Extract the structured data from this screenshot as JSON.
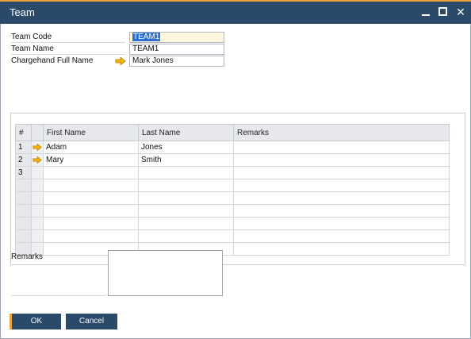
{
  "window": {
    "title": "Team"
  },
  "header": {
    "team_code": {
      "label": "Team Code",
      "value": "TEAM1"
    },
    "team_name": {
      "label": "Team Name",
      "value": "TEAM1"
    },
    "chargehand": {
      "label": "Chargehand Full Name",
      "value": "Mark Jones"
    }
  },
  "grid": {
    "columns": [
      "#",
      "",
      "First Name",
      "Last Name",
      "Remarks"
    ],
    "rows": [
      {
        "num": "1",
        "first": "Adam",
        "last": "Jones",
        "remarks": ""
      },
      {
        "num": "2",
        "first": "Mary",
        "last": "Smith",
        "remarks": ""
      },
      {
        "num": "3",
        "first": "",
        "last": "",
        "remarks": ""
      }
    ]
  },
  "remarks": {
    "label": "Remarks",
    "value": ""
  },
  "buttons": {
    "ok": "OK",
    "cancel": "Cancel"
  },
  "colors": {
    "titlebar": "#2b4968",
    "accent": "#e8a33a",
    "arrow": "#f2b200"
  },
  "icons": {
    "link_arrow": "link-arrow-icon",
    "minimize": "minimize-icon",
    "maximize": "maximize-icon",
    "close": "close-icon"
  }
}
